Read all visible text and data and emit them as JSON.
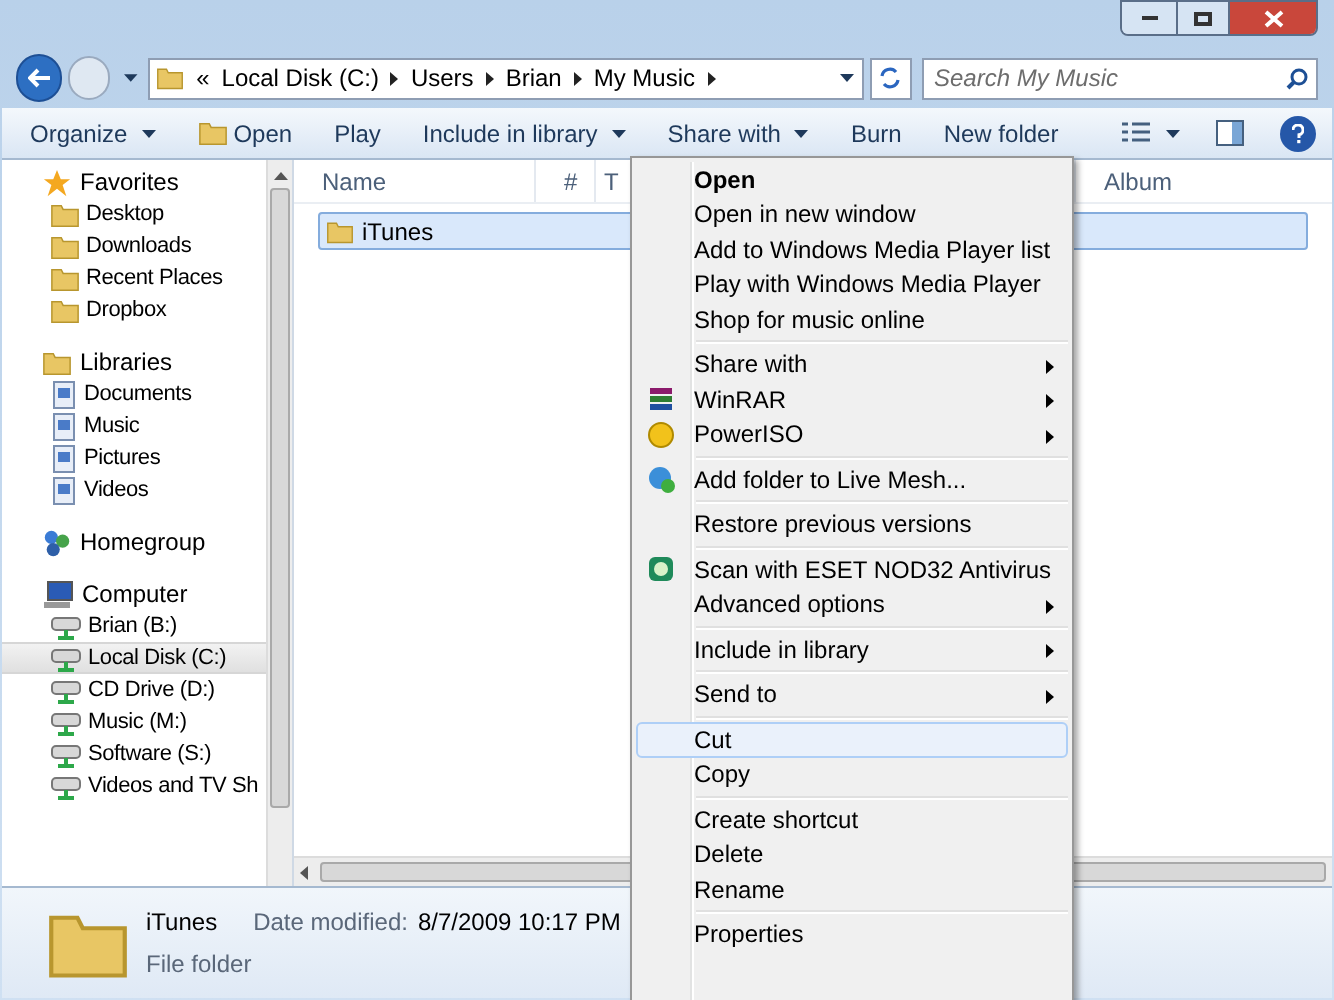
{
  "address_bar": {
    "overflow": "«",
    "crumbs": [
      "Local Disk (C:)",
      "Users",
      "Brian",
      "My Music"
    ]
  },
  "search": {
    "placeholder": "Search My Music"
  },
  "toolbar": [
    {
      "label": "Organize",
      "dropdown": true
    },
    {
      "label": "Open",
      "dropdown": false
    },
    {
      "label": "Play",
      "dropdown": false
    },
    {
      "label": "Include in library",
      "dropdown": true
    },
    {
      "label": "Share with",
      "dropdown": true
    },
    {
      "label": "Burn",
      "dropdown": false
    },
    {
      "label": "New folder",
      "dropdown": false
    }
  ],
  "nav": [
    {
      "label": "Favorites",
      "selected": false,
      "children": [
        {
          "label": "Desktop",
          "selected": false
        },
        {
          "label": "Downloads",
          "selected": false
        },
        {
          "label": "Recent Places",
          "selected": false
        },
        {
          "label": "Dropbox",
          "selected": false
        }
      ]
    },
    {
      "label": "Libraries",
      "selected": false,
      "children": [
        {
          "label": "Documents",
          "selected": false
        },
        {
          "label": "Music",
          "selected": false
        },
        {
          "label": "Pictures",
          "selected": false
        },
        {
          "label": "Videos",
          "selected": false
        }
      ]
    },
    {
      "label": "Homegroup",
      "selected": false
    },
    {
      "label": "Computer",
      "selected": false,
      "children": [
        {
          "label": "Brian (B:)",
          "selected": false
        },
        {
          "label": "Local Disk (C:)",
          "selected": true
        },
        {
          "label": "CD Drive (D:)",
          "selected": false
        },
        {
          "label": "Music (M:)",
          "selected": false
        },
        {
          "label": "Software (S:)",
          "selected": false
        },
        {
          "label": "Videos and TV Sh",
          "selected": false
        }
      ]
    }
  ],
  "columns": [
    "Name",
    "#",
    "T",
    "Album"
  ],
  "files": [
    {
      "name": "iTunes",
      "selected": true
    }
  ],
  "context_menu": [
    [
      {
        "label": "Open",
        "default": true,
        "submenu": false,
        "selected": false
      },
      {
        "label": "Open in new window",
        "default": false,
        "submenu": false,
        "selected": false
      },
      {
        "label": "Add to Windows Media Player list",
        "default": false,
        "submenu": false,
        "selected": false
      },
      {
        "label": "Play with Windows Media Player",
        "default": false,
        "submenu": false,
        "selected": false
      },
      {
        "label": "Shop for music online",
        "default": false,
        "submenu": false,
        "selected": false
      }
    ],
    [
      {
        "label": "Share with",
        "default": false,
        "submenu": true,
        "selected": false
      },
      {
        "label": "WinRAR",
        "default": false,
        "submenu": true,
        "selected": false
      },
      {
        "label": "PowerISO",
        "default": false,
        "submenu": true,
        "selected": false
      }
    ],
    [
      {
        "label": "Add folder to Live Mesh...",
        "default": false,
        "submenu": false,
        "selected": false
      }
    ],
    [
      {
        "label": "Restore previous versions",
        "default": false,
        "submenu": false,
        "selected": false
      }
    ],
    [
      {
        "label": "Scan with ESET NOD32 Antivirus",
        "default": false,
        "submenu": false,
        "selected": false
      },
      {
        "label": "Advanced options",
        "default": false,
        "submenu": true,
        "selected": false
      }
    ],
    [
      {
        "label": "Include in library",
        "default": false,
        "submenu": true,
        "selected": false
      }
    ],
    [
      {
        "label": "Send to",
        "default": false,
        "submenu": true,
        "selected": false
      }
    ],
    [
      {
        "label": "Cut",
        "default": false,
        "submenu": false,
        "selected": true
      },
      {
        "label": "Copy",
        "default": false,
        "submenu": false,
        "selected": false
      }
    ],
    [
      {
        "label": "Create shortcut",
        "default": false,
        "submenu": false,
        "selected": false
      },
      {
        "label": "Delete",
        "default": false,
        "submenu": false,
        "selected": false
      },
      {
        "label": "Rename",
        "default": false,
        "submenu": false,
        "selected": false
      }
    ],
    [
      {
        "label": "Properties",
        "default": false,
        "submenu": false,
        "selected": false
      }
    ]
  ],
  "details": {
    "name": "iTunes",
    "date_label": "Date modified:",
    "date": "8/7/2009 10:17 PM",
    "type": "File folder"
  }
}
